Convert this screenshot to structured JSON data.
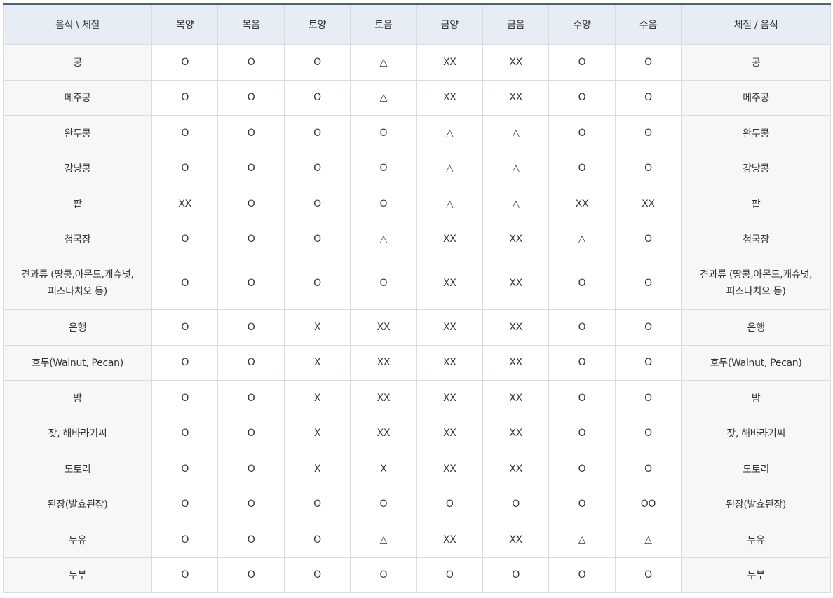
{
  "table": {
    "headers": [
      "음식 \\ 체질",
      "목양",
      "목음",
      "토양",
      "토음",
      "금양",
      "금음",
      "수양",
      "수음",
      "체질 / 음식"
    ],
    "rows": [
      {
        "name": "콩",
        "values": [
          "O",
          "O",
          "O",
          "△",
          "XX",
          "XX",
          "O",
          "O"
        ]
      },
      {
        "name": "메주콩",
        "values": [
          "O",
          "O",
          "O",
          "△",
          "XX",
          "XX",
          "O",
          "O"
        ]
      },
      {
        "name": "완두콩",
        "values": [
          "O",
          "O",
          "O",
          "O",
          "△",
          "△",
          "O",
          "O"
        ]
      },
      {
        "name": "강낭콩",
        "values": [
          "O",
          "O",
          "O",
          "O",
          "△",
          "△",
          "O",
          "O"
        ]
      },
      {
        "name": "팥",
        "values": [
          "XX",
          "O",
          "O",
          "O",
          "△",
          "△",
          "XX",
          "XX"
        ]
      },
      {
        "name": "청국장",
        "values": [
          "O",
          "O",
          "O",
          "△",
          "XX",
          "XX",
          "△",
          "O"
        ]
      },
      {
        "name": "견과류 (땅콩,아몬드,캐슈넛,\n피스타치오 등)",
        "values": [
          "O",
          "O",
          "O",
          "O",
          "XX",
          "XX",
          "O",
          "O"
        ]
      },
      {
        "name": "은행",
        "values": [
          "O",
          "O",
          "X",
          "XX",
          "XX",
          "XX",
          "O",
          "O"
        ]
      },
      {
        "name": "호두(Walnut, Pecan)",
        "values": [
          "O",
          "O",
          "X",
          "XX",
          "XX",
          "XX",
          "O",
          "O"
        ]
      },
      {
        "name": "밤",
        "values": [
          "O",
          "O",
          "X",
          "XX",
          "XX",
          "XX",
          "O",
          "O"
        ]
      },
      {
        "name": "잣, 해바라기씨",
        "values": [
          "O",
          "O",
          "X",
          "XX",
          "XX",
          "XX",
          "O",
          "O"
        ]
      },
      {
        "name": "도토리",
        "values": [
          "O",
          "O",
          "X",
          "X",
          "XX",
          "XX",
          "O",
          "O"
        ]
      },
      {
        "name": "된장(발효된장)",
        "values": [
          "O",
          "O",
          "O",
          "O",
          "O",
          "O",
          "O",
          "OO"
        ]
      },
      {
        "name": "두유",
        "values": [
          "O",
          "O",
          "O",
          "△",
          "XX",
          "XX",
          "△",
          "△"
        ]
      },
      {
        "name": "두부",
        "values": [
          "O",
          "O",
          "O",
          "O",
          "O",
          "O",
          "O",
          "O"
        ]
      }
    ]
  },
  "colors": {
    "header_bg": "#e6edf4",
    "top_border": "#4d6279",
    "name_cell_bg": "#f7f7f7",
    "grid_line": "#d9dde2"
  }
}
